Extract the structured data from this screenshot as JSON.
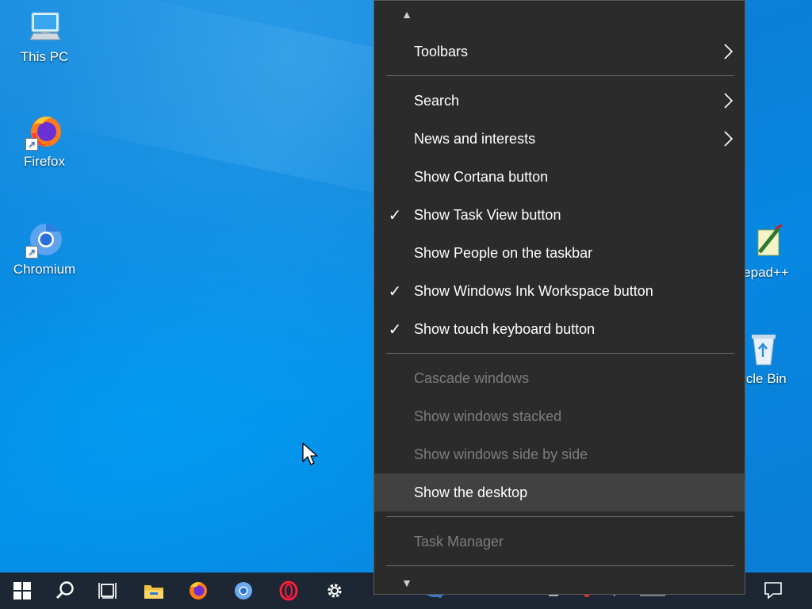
{
  "desktop": {
    "icons": [
      {
        "label": "This PC",
        "icon": "this-pc-icon"
      },
      {
        "label": "Firefox",
        "icon": "firefox-icon"
      },
      {
        "label": "Chromium",
        "icon": "chromium-icon"
      },
      {
        "label": "epad++",
        "icon": "notepad-plus-plus-icon"
      },
      {
        "label": "ycle Bin",
        "icon": "recycle-bin-icon"
      }
    ]
  },
  "context_menu": {
    "items": [
      {
        "label": "Toolbars",
        "checked": false,
        "submenu": true,
        "disabled": false
      },
      {
        "label": "Search",
        "checked": false,
        "submenu": true,
        "disabled": false
      },
      {
        "label": "News and interests",
        "checked": false,
        "submenu": true,
        "disabled": false
      },
      {
        "label": "Show Cortana button",
        "checked": false,
        "submenu": false,
        "disabled": false
      },
      {
        "label": "Show Task View button",
        "checked": true,
        "submenu": false,
        "disabled": false
      },
      {
        "label": "Show People on the taskbar",
        "checked": false,
        "submenu": false,
        "disabled": false
      },
      {
        "label": "Show Windows Ink Workspace button",
        "checked": true,
        "submenu": false,
        "disabled": false
      },
      {
        "label": "Show touch keyboard button",
        "checked": true,
        "submenu": false,
        "disabled": false
      },
      {
        "label": "Cascade windows",
        "checked": false,
        "submenu": false,
        "disabled": true
      },
      {
        "label": "Show windows stacked",
        "checked": false,
        "submenu": false,
        "disabled": true
      },
      {
        "label": "Show windows side by side",
        "checked": false,
        "submenu": false,
        "disabled": true
      },
      {
        "label": "Show the desktop",
        "checked": false,
        "submenu": false,
        "disabled": false,
        "highlighted": true
      },
      {
        "label": "Task Manager",
        "checked": false,
        "submenu": false,
        "disabled": true
      }
    ],
    "check_glyph": "✓"
  },
  "taskbar": {
    "buttons": [
      "start-button",
      "search-button",
      "task-view-button",
      "file-explorer-button",
      "firefox-button",
      "chromium-button",
      "opera-button",
      "settings-button"
    ],
    "tray_icons": [
      "network-icon",
      "volume-muted-icon",
      "pen-icon",
      "keyboard-icon",
      "notification-icon"
    ]
  },
  "colors": {
    "menu_bg": "#2b2b2b",
    "menu_hover": "#414141",
    "menu_disabled_text": "#7d7d7d",
    "taskbar_bg": "#1c2733",
    "desktop_blue": "#0a86dc"
  }
}
